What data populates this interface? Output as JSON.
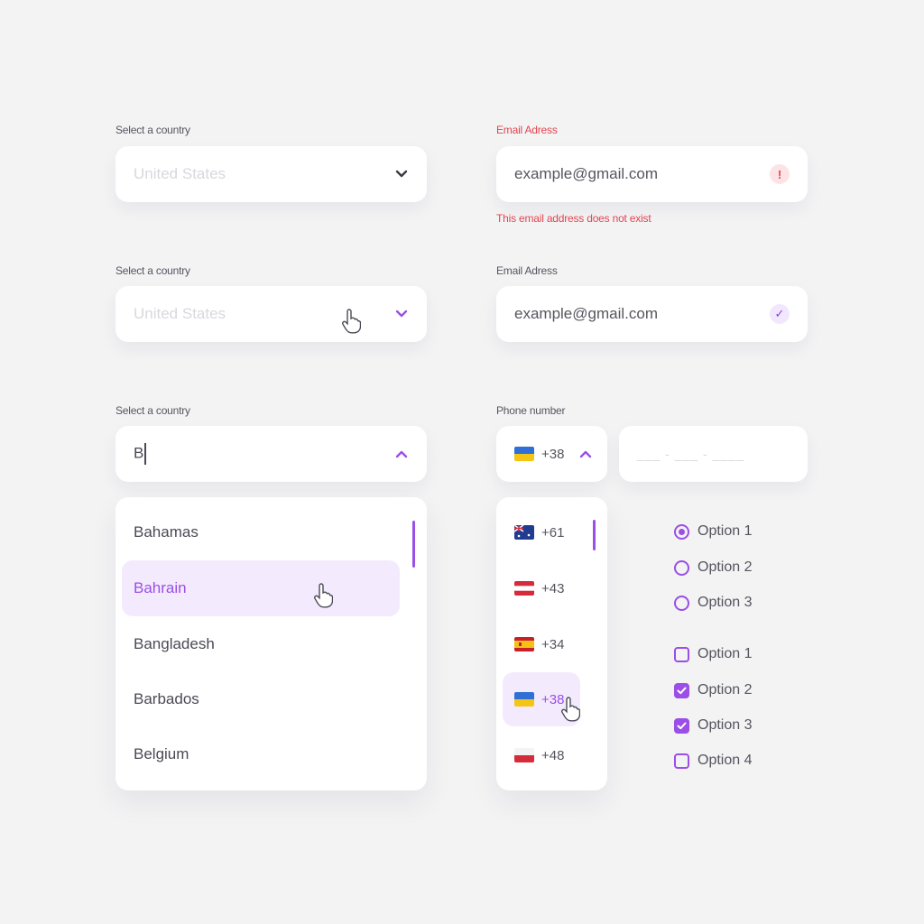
{
  "country_select_default": {
    "label": "Select a country",
    "placeholder": "United States"
  },
  "country_select_hover": {
    "label": "Select a country",
    "placeholder": "United States"
  },
  "country_select_open": {
    "label": "Select a country",
    "typed_value": "B",
    "options": [
      "Bahamas",
      "Bahrain",
      "Bangladesh",
      "Barbados",
      "Belgium"
    ],
    "highlighted": "Bahrain"
  },
  "email_error": {
    "label": "Email Adress",
    "value": "example@gmail.com",
    "error_message": "This email address does not exist",
    "status_icon": "!"
  },
  "email_valid": {
    "label": "Email Adress",
    "value": "example@gmail.com",
    "status_icon": "✓"
  },
  "phone": {
    "label": "Phone number",
    "selected_code": "+38",
    "number_placeholder": "___ - ___ - ____",
    "codes": [
      {
        "code": "+61",
        "flag": "australia-flag-icon"
      },
      {
        "code": "+43",
        "flag": "austria-flag-icon"
      },
      {
        "code": "+34",
        "flag": "spain-flag-icon"
      },
      {
        "code": "+38",
        "flag": "ukraine-flag-icon"
      },
      {
        "code": "+48",
        "flag": "poland-flag-icon"
      }
    ]
  },
  "radios": [
    "Option 1",
    "Option 2",
    "Option 3"
  ],
  "checkboxes": [
    "Option 1",
    "Option 2",
    "Option 3",
    "Option 4"
  ],
  "colors": {
    "accent": "#9b4fe6",
    "error": "#e2454f",
    "background": "#f3f3f4"
  }
}
